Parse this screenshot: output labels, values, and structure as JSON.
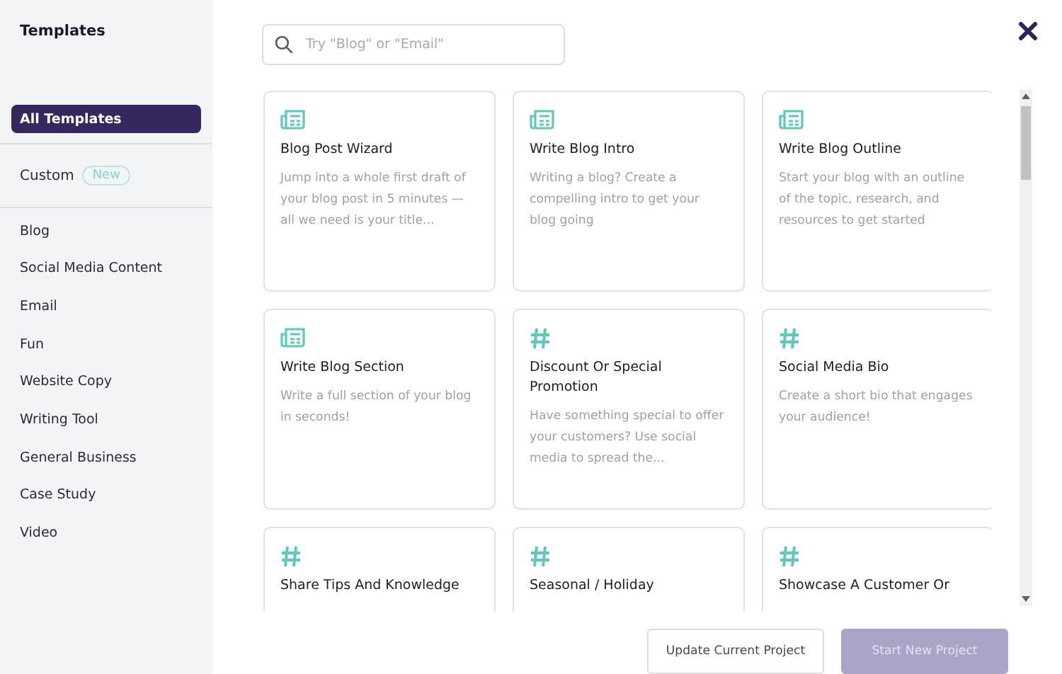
{
  "sidebar": {
    "title": "Templates",
    "top_items": [
      {
        "label": "All Templates",
        "selected": true
      }
    ],
    "custom": {
      "label": "Custom",
      "badge": "New",
      "selected": false
    },
    "categories": [
      {
        "label": "Blog",
        "selected": false
      },
      {
        "label": "Social Media Content",
        "selected": false
      },
      {
        "label": "Email",
        "selected": false
      },
      {
        "label": "Fun",
        "selected": false
      },
      {
        "label": "Website Copy",
        "selected": false
      },
      {
        "label": "Writing Tool",
        "selected": false
      },
      {
        "label": "General Business",
        "selected": false
      },
      {
        "label": "Case Study",
        "selected": false
      },
      {
        "label": "Video",
        "selected": false
      }
    ]
  },
  "search": {
    "placeholder": "Try \"Blog\" or \"Email\""
  },
  "templates": [
    {
      "kind": "blog",
      "title": "Blog Post Wizard",
      "description": "Jump into a whole first draft of your blog post in 5 minutes — all we need is your title..."
    },
    {
      "kind": "blog",
      "title": "Write Blog Intro",
      "description": "Writing a blog? Create a compelling intro to get your blog going"
    },
    {
      "kind": "blog",
      "title": "Write Blog Outline",
      "description": "Start your blog with an outline of the topic, research, and resources to get started"
    },
    {
      "kind": "blog",
      "title": "Write Blog Section",
      "description": "Write a full section of your blog in seconds!"
    },
    {
      "kind": "hashtag",
      "title": "Discount Or Special Promotion",
      "description": "Have something special to offer your customers? Use social media to spread the..."
    },
    {
      "kind": "hashtag",
      "title": "Social Media Bio",
      "description": "Create a short bio that engages your audience!"
    },
    {
      "kind": "hashtag",
      "title": "Share Tips And Knowledge"
    },
    {
      "kind": "hashtag",
      "title": "Seasonal / Holiday"
    },
    {
      "kind": "hashtag",
      "title": "Showcase A Customer Or"
    }
  ],
  "buttons": [
    {
      "label": "Update Current Project",
      "kind": "secondary",
      "disabled": false
    },
    {
      "label": "Start New Project",
      "kind": "primary",
      "disabled": true
    }
  ]
}
